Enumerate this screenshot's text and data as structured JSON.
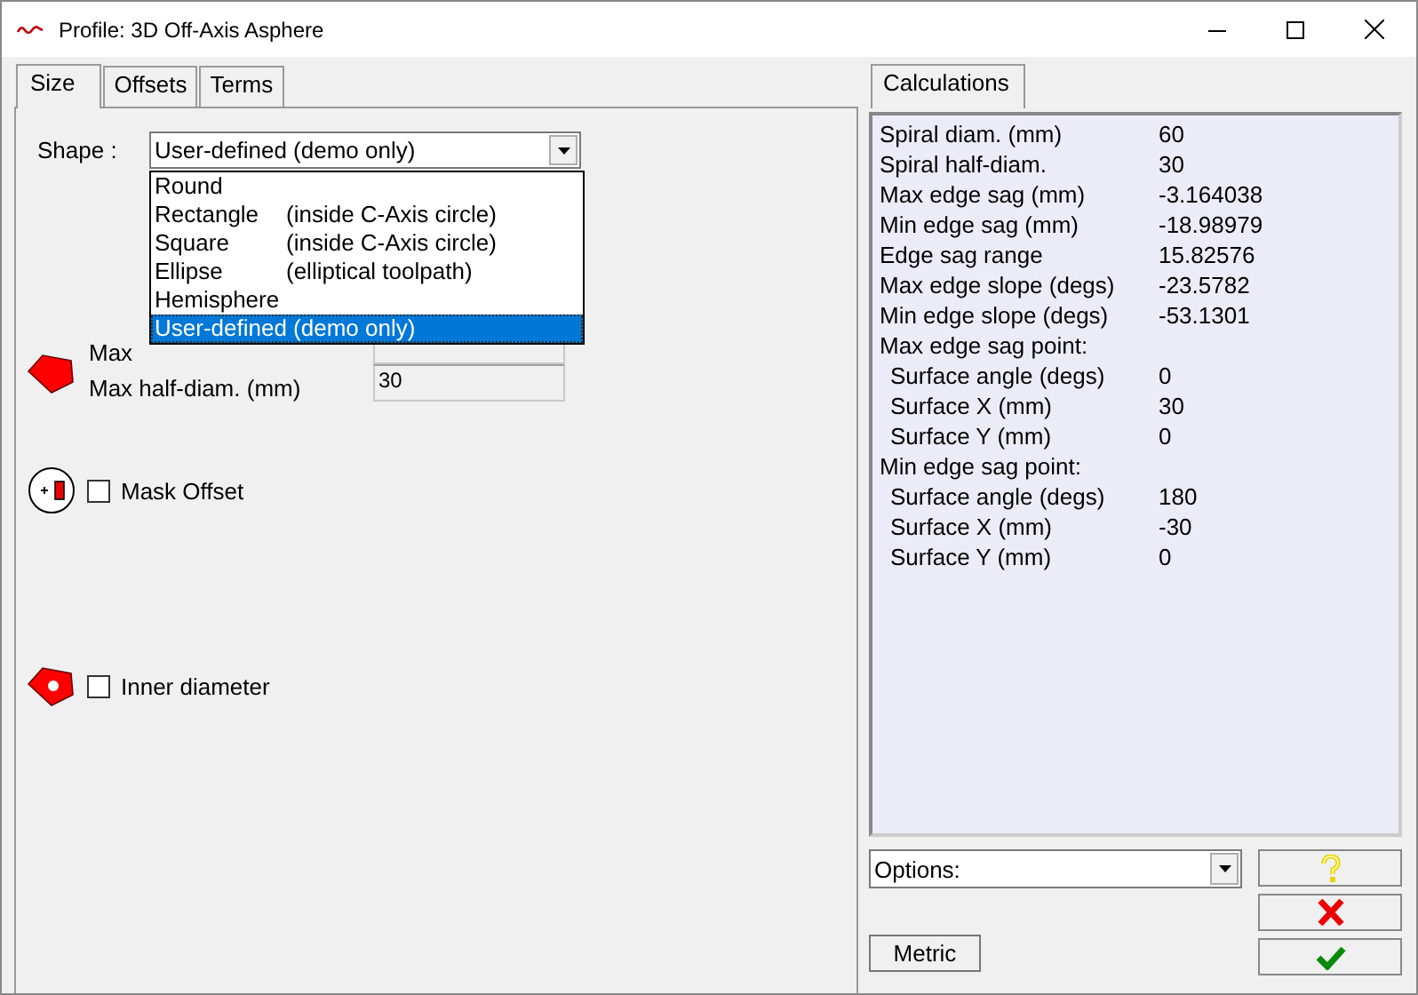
{
  "window": {
    "title": "Profile: 3D Off-Axis Asphere"
  },
  "left_tabs": [
    {
      "label": "Size",
      "selected": true
    },
    {
      "label": "Offsets",
      "selected": false
    },
    {
      "label": "Terms",
      "selected": false
    }
  ],
  "shape": {
    "label": "Shape :",
    "value": "User-defined (demo only)",
    "expanded": true,
    "options": [
      {
        "name": "Round",
        "selected": false
      },
      {
        "name": "Rectangle",
        "note": "(inside C-Axis circle)",
        "selected": false
      },
      {
        "name": "Square",
        "note": "(inside C-Axis circle)",
        "selected": false
      },
      {
        "name": "Ellipse",
        "note": "(elliptical toolpath)",
        "selected": false
      },
      {
        "name": "Hemisphere",
        "selected": false
      },
      {
        "name": "User-defined (demo only)",
        "selected": true
      }
    ]
  },
  "fields": [
    {
      "label": "Max"
    },
    {
      "label": "Max half-diam. (mm)",
      "value": "30"
    }
  ],
  "checkboxes": [
    {
      "label": "Mask Offset",
      "checked": false
    },
    {
      "label": "Inner diameter",
      "checked": false
    }
  ],
  "right_tabs": [
    {
      "label": "Calculations",
      "selected": true
    }
  ],
  "calculations": [
    {
      "label": "Spiral diam. (mm)",
      "value": "60"
    },
    {
      "label": "Spiral half-diam.",
      "value": "30"
    },
    {
      "label": "Max edge sag (mm)",
      "value": "-3.164038"
    },
    {
      "label": "Min edge sag (mm)",
      "value": "-18.98979"
    },
    {
      "label": "Edge sag range",
      "value": "15.82576"
    },
    {
      "label": "Max edge slope (degs)",
      "value": "-23.5782"
    },
    {
      "label": "Min edge slope (degs)",
      "value": "-53.1301"
    },
    {
      "label": "Max edge sag point:",
      "children": [
        {
          "label": "Surface angle (degs)",
          "value": "0"
        },
        {
          "label": "Surface X (mm)",
          "value": "30"
        },
        {
          "label": "Surface Y (mm)",
          "value": "0"
        }
      ]
    },
    {
      "label": "Min edge sag point:",
      "children": [
        {
          "label": "Surface angle (degs)",
          "value": "180"
        },
        {
          "label": "Surface X (mm)",
          "value": "-30"
        },
        {
          "label": "Surface Y (mm)",
          "value": "0"
        }
      ]
    }
  ],
  "options": {
    "value": "Options:"
  },
  "metric_button": "Metric"
}
